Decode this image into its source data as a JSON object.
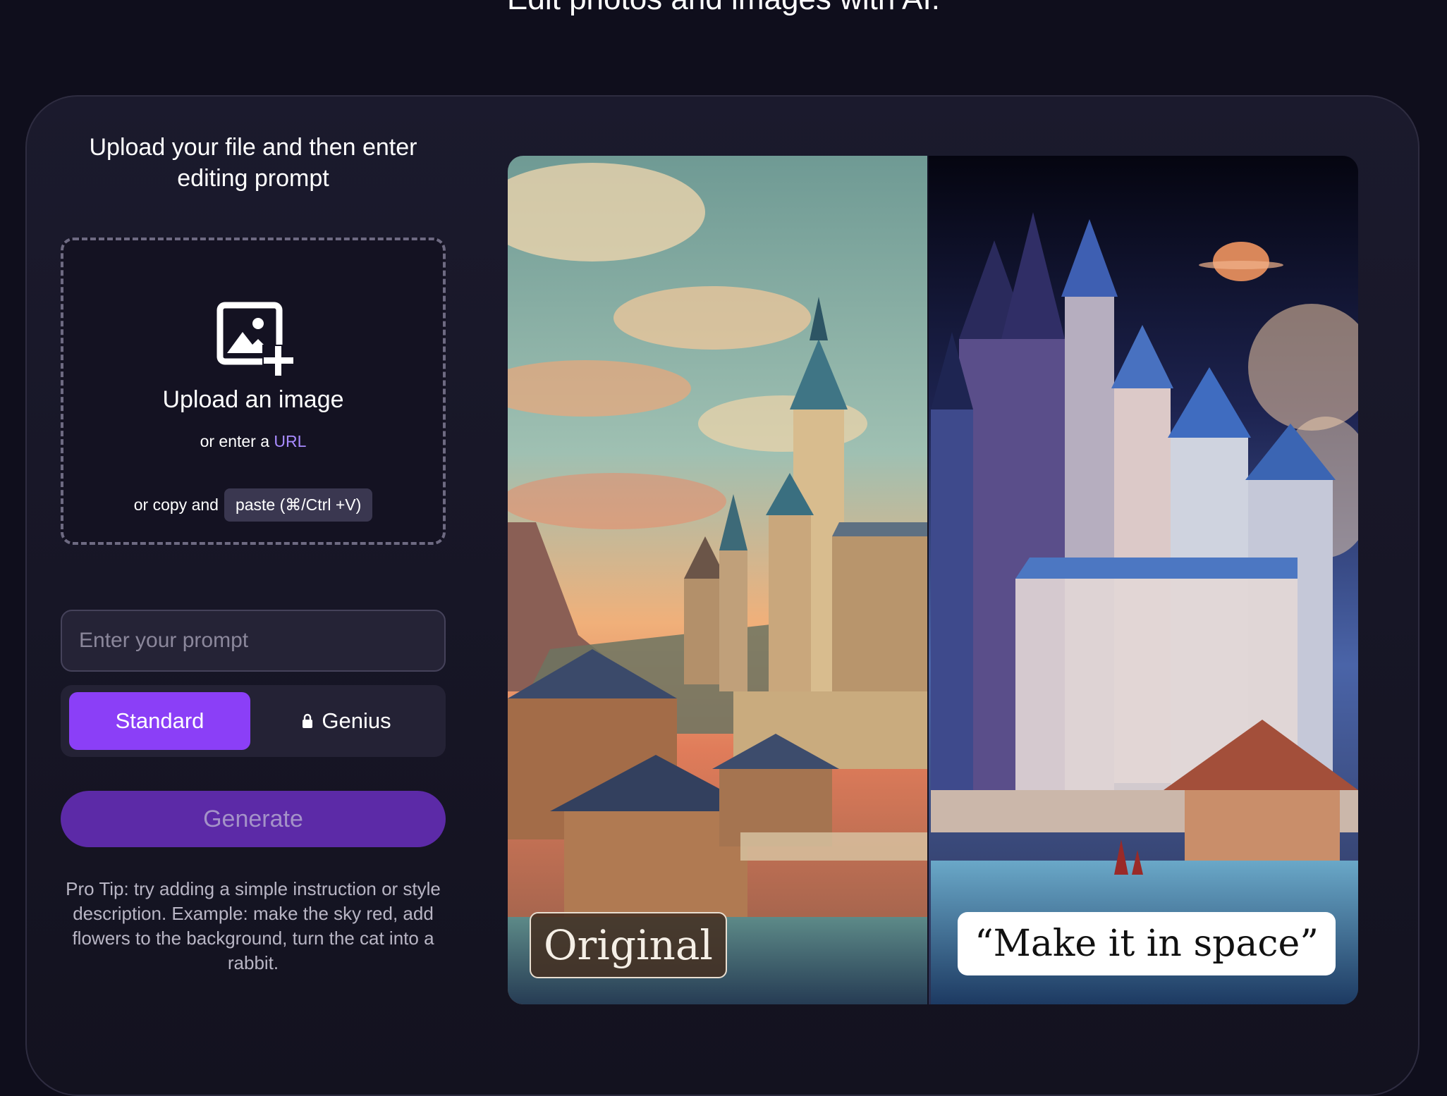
{
  "page": {
    "heading": "Edit photos and images with AI."
  },
  "upload_panel": {
    "heading": "Upload your file and then enter editing prompt",
    "dropzone": {
      "icon": "image-add-icon",
      "title": "Upload an image",
      "url_prefix": "or enter a",
      "url_link": "URL",
      "paste_prefix": "or copy and",
      "paste_label": "paste (⌘/Ctrl +V)"
    },
    "prompt_placeholder": "Enter your prompt",
    "prompt_value": "",
    "modes": {
      "standard_label": "Standard",
      "genius_label": "Genius",
      "genius_icon": "lock-icon",
      "selected": "Standard"
    },
    "generate_label": "Generate",
    "pro_tip": "Pro Tip: try adding a simple instruction or style description. Example: make the sky red, add flowers to the background, turn the cat into a rabbit."
  },
  "preview": {
    "original_label": "Original",
    "edited_label": "“Make it in space”"
  },
  "colors": {
    "background": "#0f0e1c",
    "accent": "#8b3ff7",
    "generate_button": "#5c2aa7",
    "link": "#a88bff"
  }
}
